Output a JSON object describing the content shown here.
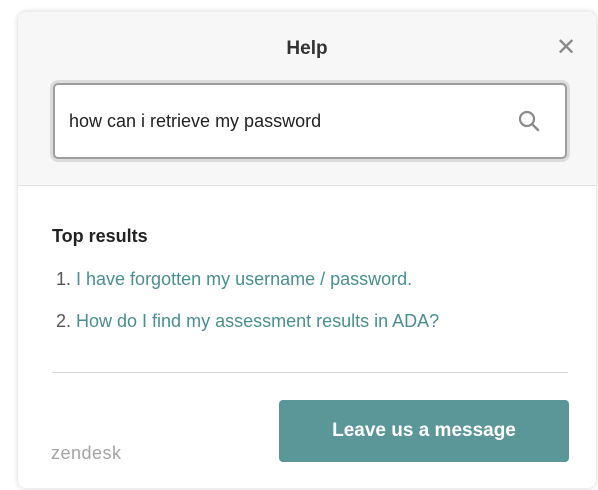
{
  "header": {
    "title": "Help",
    "close_icon": "close-icon"
  },
  "search": {
    "value": "how can i retrieve my password",
    "icon": "search-icon"
  },
  "results": {
    "heading": "Top results",
    "items": [
      {
        "number": "1.",
        "label": "I have forgotten my username / password."
      },
      {
        "number": "2.",
        "label": "How do I find my assessment results in ADA?"
      }
    ]
  },
  "footer": {
    "brand": "zendesk",
    "message_button": "Leave us a message"
  },
  "colors": {
    "accent": "#5b9698",
    "link": "#4a8f8f"
  }
}
